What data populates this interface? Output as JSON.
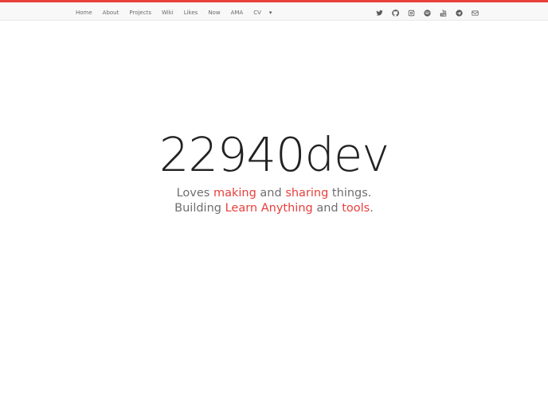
{
  "nav": {
    "items": [
      "Home",
      "About",
      "Projects",
      "Wiki",
      "Likes",
      "Now",
      "AMA",
      "CV"
    ],
    "more_caret": "▾"
  },
  "social": {
    "icons": [
      "twitter-icon",
      "github-icon",
      "instagram-icon",
      "spotify-icon",
      "youtube-icon",
      "telegram-icon",
      "email-icon"
    ]
  },
  "hero": {
    "title": "22940dev",
    "line1": {
      "w1": "Loves ",
      "h1": "making",
      "w2": " and ",
      "h2": "sharing",
      "w3": " things."
    },
    "line2": {
      "w1": "Building ",
      "h1": "Learn Anything",
      "w2": " and ",
      "h2": "tools",
      "w3": "."
    }
  },
  "colors": {
    "accent": "#e8403c",
    "text_dark": "#222222",
    "text_muted": "#6e6e6e",
    "topbar_bg": "#f8f8f8"
  }
}
